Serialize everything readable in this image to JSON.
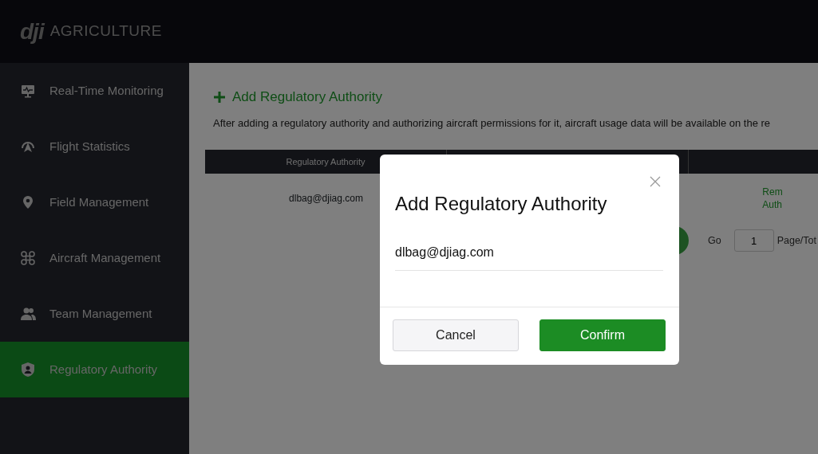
{
  "header": {
    "logo": "dji",
    "product": "AGRICULTURE"
  },
  "sidebar": {
    "items": [
      {
        "label": "Real-Time Monitoring",
        "kind": "monitor",
        "selected": false
      },
      {
        "label": "Flight Statistics",
        "kind": "statistics",
        "selected": false
      },
      {
        "label": "Field Management",
        "kind": "pin",
        "selected": false
      },
      {
        "label": "Aircraft Management",
        "kind": "drone",
        "selected": false
      },
      {
        "label": "Team Management",
        "kind": "team",
        "selected": false
      },
      {
        "label": "Regulatory Authority",
        "kind": "shield",
        "selected": true
      }
    ]
  },
  "content": {
    "add_link": "Add Regulatory Authority",
    "description": "After adding a regulatory authority and authorizing aircraft permissions for it, aircraft usage data will be available on the re",
    "table": {
      "columns": [
        "Regulatory Authority"
      ],
      "rows": [
        {
          "authority": "dlbag@djiag.com",
          "action": [
            "Rem",
            "Auth"
          ]
        }
      ]
    },
    "pagination": {
      "go_label": "Go",
      "page_value": "1",
      "page_label": "Page/Tot"
    }
  },
  "modal": {
    "title": "Add Regulatory Authority",
    "value": "dlbag@djiag.com",
    "buttons": [
      {
        "label": "Cancel",
        "kind": "secondary"
      },
      {
        "label": "Confirm",
        "kind": "primary"
      }
    ]
  }
}
